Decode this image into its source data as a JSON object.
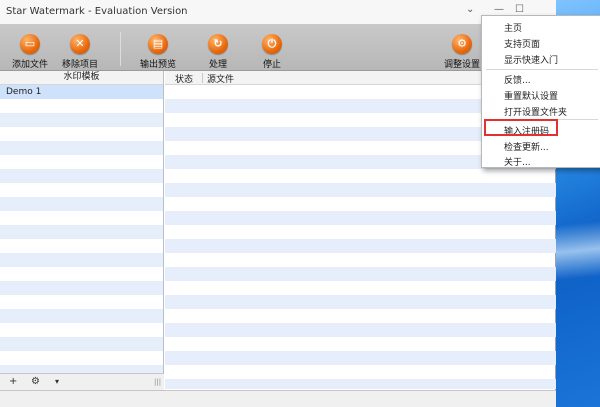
{
  "window": {
    "title": "Star Watermark - Evaluation Version",
    "controls": [
      "⌄",
      "—",
      "☐"
    ]
  },
  "toolbar": {
    "buttons": [
      {
        "label": "添加文件",
        "icon": "add-file-icon"
      },
      {
        "label": "移除项目",
        "icon": "remove-item-icon"
      },
      {
        "label": "输出预览",
        "icon": "output-preview-icon"
      },
      {
        "label": "处理",
        "icon": "process-icon"
      },
      {
        "label": "停止",
        "icon": "stop-icon"
      },
      {
        "label": "调整设置",
        "icon": "settings-icon"
      }
    ]
  },
  "left_panel": {
    "header": "水印模板",
    "items": [
      "Demo 1"
    ],
    "footer": {
      "add": "+",
      "gear": "⚙",
      "dropdown": "▾",
      "grip": "|||"
    }
  },
  "right_panel": {
    "columns": [
      "状态",
      "源文件"
    ]
  },
  "menu": {
    "items": [
      "主页",
      "支持页面",
      "显示快速入门",
      "反馈...",
      "重置默认设置",
      "打开设置文件夹",
      "输入注册码",
      "检查更新...",
      "关于..."
    ],
    "highlighted_index": 6
  },
  "colors": {
    "accent_orange": "#e86a0e",
    "row_alt": "#e6eefc",
    "highlight_red": "#e53030"
  }
}
